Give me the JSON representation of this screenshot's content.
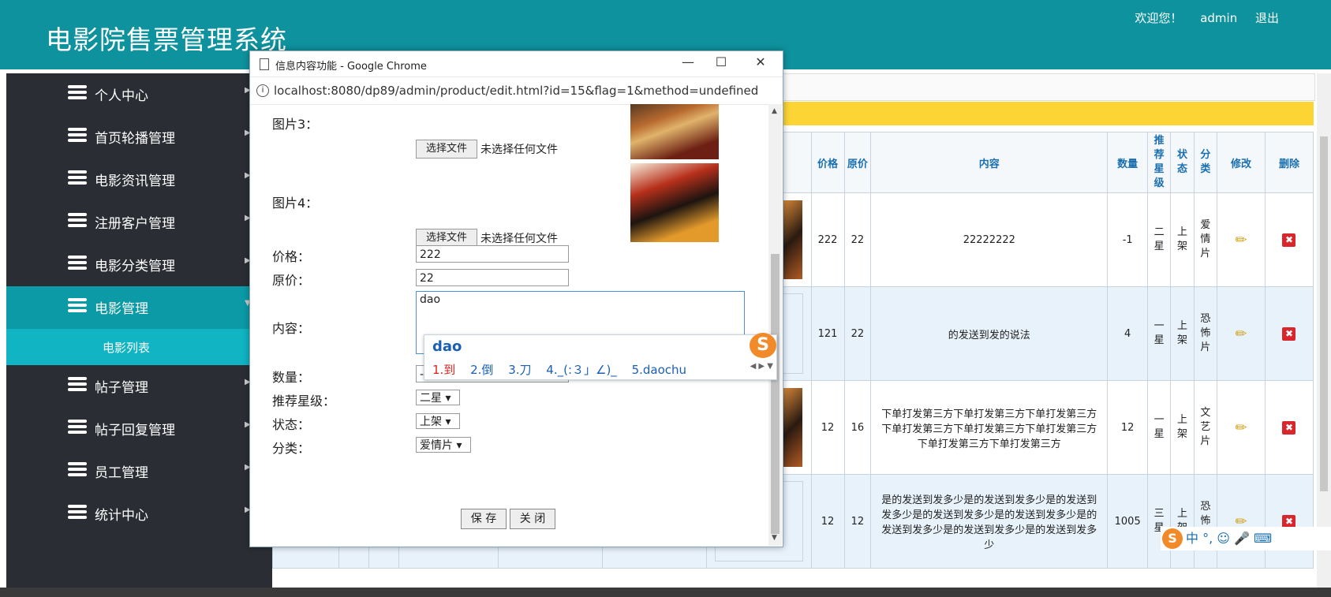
{
  "header": {
    "title": "电影院售票管理系统",
    "welcome": "欢迎您！",
    "user": "admin",
    "logout": "退出"
  },
  "sidebar": {
    "items": [
      {
        "label": "个人中心"
      },
      {
        "label": "首页轮播管理"
      },
      {
        "label": "电影资讯管理"
      },
      {
        "label": "注册客户管理"
      },
      {
        "label": "电影分类管理"
      },
      {
        "label": "电影管理"
      },
      {
        "label": "帖子管理"
      },
      {
        "label": "帖子回复管理"
      },
      {
        "label": "员工管理"
      },
      {
        "label": "统计中心"
      }
    ],
    "sub_item": "电影列表"
  },
  "table": {
    "headers": [
      "价格",
      "原价",
      "内容",
      "数量",
      "推荐星级",
      "状态",
      "分类",
      "修改",
      "删除"
    ],
    "rows": [
      {
        "price": "222",
        "orig": "22",
        "content": "22222222",
        "qty": "-1",
        "star": "二星",
        "status": "上架",
        "cat": "爱情片"
      },
      {
        "price": "121",
        "orig": "22",
        "content": "的发送到发的说法",
        "qty": "4",
        "star": "一星",
        "status": "上架",
        "cat": "恐怖片"
      },
      {
        "price": "12",
        "orig": "16",
        "content": "下单打发第三方下单打发第三方下单打发第三方下单打发第三方下单打发第三方下单打发第三方下单打发第三方下单打发第三方",
        "qty": "12",
        "star": "一星",
        "status": "上架",
        "cat": "文艺片"
      },
      {
        "price": "12",
        "orig": "12",
        "content": "是的发送到发多少是的发送到发多少是的发送到发多少是的发送到发多少是的发送到发多少是的发送到发多少是的发送到发多少是的发送到发多少",
        "qty": "1005",
        "star": "三星",
        "status": "上架",
        "cat": "恐怖片"
      }
    ]
  },
  "popup": {
    "window_title": "信息内容功能 - Google Chrome",
    "url": "localhost:8080/dp89/admin/product/edit.html?id=15&flag=1&method=undefined",
    "fields": {
      "pic3_label": "图片3：",
      "pic4_label": "图片4：",
      "file_button": "选择文件",
      "no_file": "未选择任何文件",
      "price_label": "价格：",
      "price_value": "222",
      "orig_label": "原价：",
      "orig_value": "22",
      "content_label": "内容：",
      "content_value": "dao",
      "qty_label": "数量：",
      "qty_value": "-1",
      "star_label": "推荐星级：",
      "star_value": "二星",
      "status_label": "状态：",
      "status_value": "上架",
      "cat_label": "分类：",
      "cat_value": "爱情片"
    },
    "save_button": "保 存",
    "close_button": "关 闭"
  },
  "ime": {
    "pinyin": "dao",
    "candidates": [
      "1.到",
      "2.倒",
      "3.刀",
      "4._(:３」∠)_",
      "5.daochu"
    ],
    "toolbar": "中 °, ☺ 🎤 ⌨"
  },
  "colors": {
    "header_bg": "#0e929d",
    "sidebar_bg": "#2a2d33",
    "active_bg": "#0b9aa6",
    "sub_bg": "#10b4c2",
    "notice_bar": "#fcd535",
    "delete_red": "#d9262c"
  }
}
